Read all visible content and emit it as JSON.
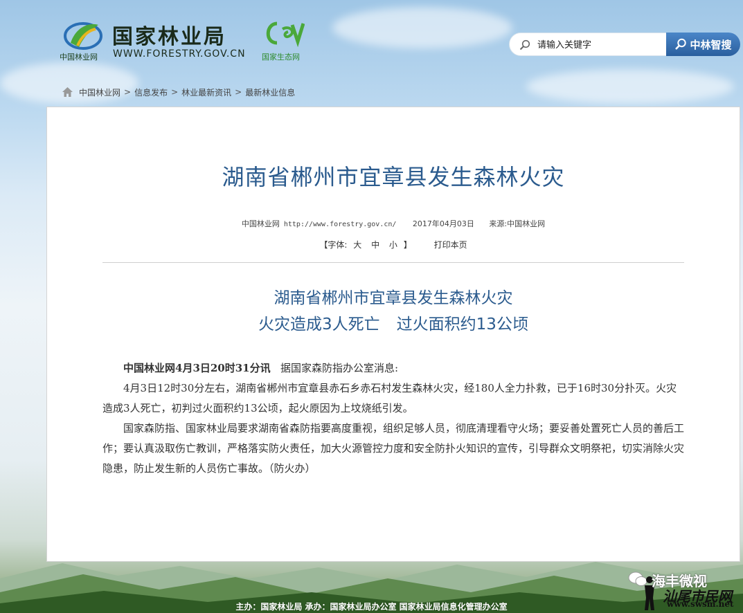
{
  "header": {
    "logo_sub": "中国林业网",
    "logo_title": "国家林业局",
    "logo_url": "WWW.FORESTRY.GOV.CN",
    "eco_sub": "国家生态网"
  },
  "search": {
    "placeholder": "请输入关键字",
    "button_label": "中林智搜"
  },
  "breadcrumb": {
    "items": [
      "中国林业网",
      "信息发布",
      "林业最新资讯",
      "最新林业信息"
    ],
    "separator": ">"
  },
  "article": {
    "title": "湖南省郴州市宜章县发生森林火灾",
    "meta": {
      "site": "中国林业网",
      "url": "http://www.forestry.gov.cn/",
      "date": "2017年04月03日",
      "source": "来源:中国林业网"
    },
    "tools": {
      "font_size_open": "【字体:",
      "size_large": "大",
      "size_medium": "中",
      "size_small": "小",
      "font_size_close": "】",
      "print": "打印本页"
    },
    "headline_line1": "湖南省郴州市宜章县发生森林火灾",
    "headline_line2a": "火灾造成3人死亡",
    "headline_line2b": "过火面积约13公顷",
    "paragraphs": {
      "p1_lead": "中国林业网4月3日20时31分讯",
      "p1_rest": "据国家森防指办公室消息:",
      "p2": "4月3日12时30分左右，湖南省郴州市宜章县赤石乡赤石村发生森林火灾，经180人全力扑救，已于16时30分扑灭。火灾造成3人死亡，初判过火面积约13公顷，起火原因为上坟烧纸引发。",
      "p3": "国家森防指、国家林业局要求湖南省森防指要高度重视，组织足够人员，彻底清理看守火场；要妥善处置死亡人员的善后工作；要认真汲取伤亡教训，严格落实防火责任，加大火源管控力度和安全防扑火知识的宣传，引导群众文明祭祀，切实消除火灾隐患，防止发生新的人员伤亡事故。（防火办）"
    }
  },
  "footer": {
    "text": "主办：国家林业局 承办：国家林业局办公室 国家林业局信息化管理办公室"
  },
  "watermark": {
    "line1": "海丰微视",
    "line2": "汕尾市民网",
    "line3": "www.swsm.net"
  },
  "colors": {
    "title_blue": "#2b5b8e",
    "search_button": "#2a5f9e"
  }
}
